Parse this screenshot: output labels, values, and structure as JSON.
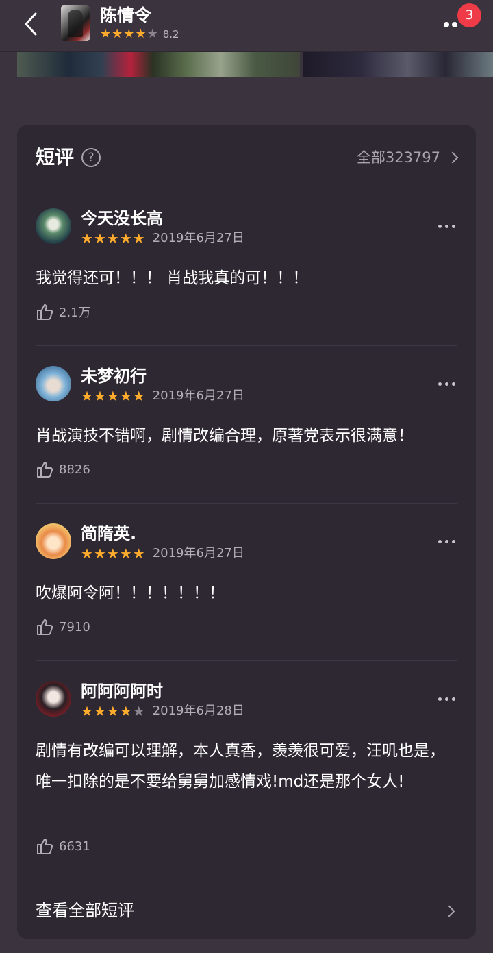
{
  "header": {
    "title": "陈情令",
    "rating": 8.2,
    "score_text": "8.2",
    "stars": [
      1,
      1,
      1,
      1,
      0
    ],
    "notification_count": "3"
  },
  "short_reviews": {
    "title": "短评",
    "all_count_label": "全部323797",
    "reviews": [
      {
        "user": "今天没长高",
        "stars": [
          1,
          1,
          1,
          1,
          1
        ],
        "date": "2019年6月27日",
        "text": "我觉得还可！！！ 肖战我真的可！！！",
        "likes": "2.1万"
      },
      {
        "user": "未梦初行",
        "stars": [
          1,
          1,
          1,
          1,
          1
        ],
        "date": "2019年6月27日",
        "text": "肖战演技不错啊，剧情改编合理，原著党表示很满意！",
        "likes": "8826"
      },
      {
        "user": "简隋英.",
        "stars": [
          1,
          1,
          1,
          1,
          1
        ],
        "date": "2019年6月27日",
        "text": "吹爆阿令阿！！！！！！！",
        "likes": "7910"
      },
      {
        "user": "阿阿阿阿时",
        "stars": [
          1,
          1,
          1,
          1,
          0
        ],
        "date": "2019年6月28日",
        "text": "剧情有改编可以理解，本人真香，羡羡很可爱，汪叽也是，唯一扣除的是不要给舅舅加感情戏!md还是那个女人!",
        "likes": "6631"
      }
    ],
    "view_all_label": "查看全部短评"
  },
  "colors": {
    "background": "#3b343f",
    "card": "#2e2833",
    "star": "#ffac2d",
    "badge": "#ef3b48"
  }
}
